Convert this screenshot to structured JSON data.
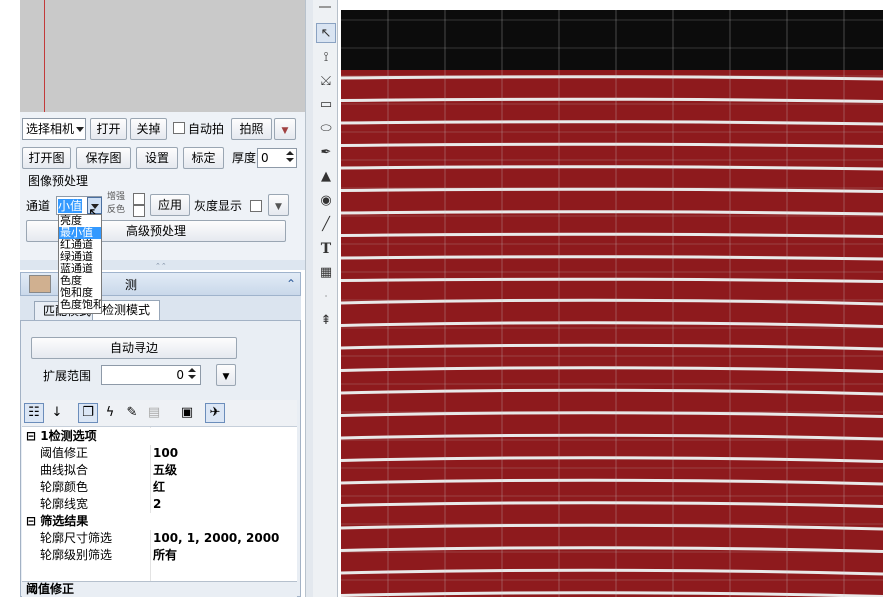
{
  "camera": {
    "select_label": "选择相机",
    "open_label": "打开",
    "close_label": "关掉",
    "auto_capture_label": "自动拍",
    "capture_label": "拍照"
  },
  "file": {
    "open_image_label": "打开图",
    "save_image_label": "保存图",
    "settings_label": "设置",
    "calibrate_label": "标定",
    "thickness_label": "厚度",
    "thickness_value": "0"
  },
  "preprocess": {
    "section_title": "图像预处理",
    "channel_label": "通道",
    "channel_value": "小值",
    "enhance_label": "增强",
    "invert_label": "反色",
    "apply_label": "应用",
    "gray_display_label": "灰度显示",
    "advanced_label": "高级预处理",
    "channel_options": [
      "亮度",
      "最小值",
      "红通道",
      "绿通道",
      "蓝通道",
      "色度",
      "饱和度",
      "色度饱和"
    ],
    "channel_selected_index": 1
  },
  "detect": {
    "header_label": "测",
    "tabs": [
      {
        "label": "匹配模式",
        "active": false
      },
      {
        "label": "检测模式",
        "active": true
      }
    ],
    "auto_edge_label": "自动寻边",
    "extend_range_label": "扩展范围",
    "extend_range_value": "0"
  },
  "properties": {
    "categories": [
      {
        "title": "1检测选项",
        "rows": [
          {
            "key": "阈值修正",
            "value": "100"
          },
          {
            "key": "曲线拟合",
            "value": "五级"
          },
          {
            "key": "轮廓颜色",
            "value": "红"
          },
          {
            "key": "轮廓线宽",
            "value": "2"
          }
        ]
      },
      {
        "title": "筛选结果",
        "rows": [
          {
            "key": "轮廓尺寸筛选",
            "value": "100, 1, 2000, 2000"
          },
          {
            "key": "轮廓级别筛选",
            "value": "所有"
          }
        ]
      }
    ],
    "description_title": "阈值修正"
  },
  "toolbox": {
    "tools": [
      "pointer-icon",
      "node-edit-icon",
      "bezier-icon",
      "rectangle-icon",
      "ellipse-icon",
      "pen-icon",
      "triangle-icon",
      "camera-icon",
      "line-icon",
      "text-icon",
      "table-icon",
      "dot-icon",
      "connector-icon"
    ]
  },
  "colors": {
    "fabric_red": "#8e1a1d",
    "stripe_white": "#e9e9e9",
    "grid": "#c8c8c8",
    "selection": "#3399ff"
  }
}
